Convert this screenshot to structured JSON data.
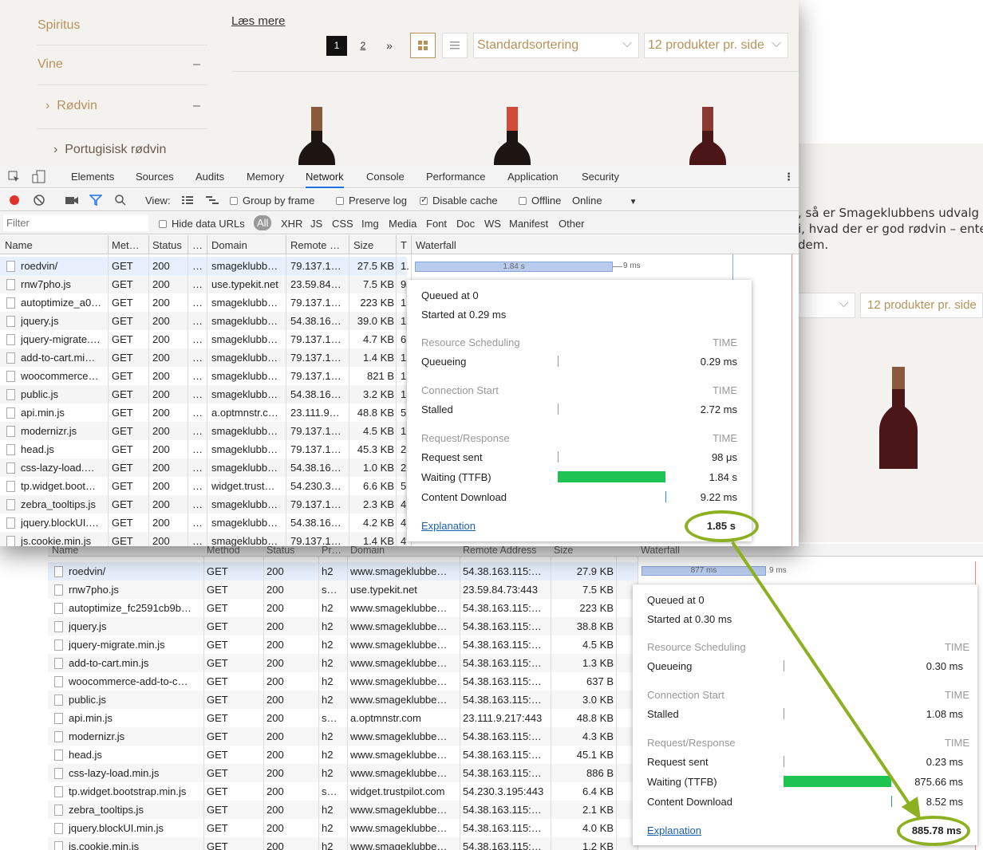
{
  "site": {
    "read_more": "Læs mere",
    "sidebar": [
      "Spiritus",
      "Vine",
      "Rødvin",
      "Portugisisk rødvin"
    ],
    "sidebar_minus": "–",
    "pagination": [
      "1",
      "2",
      "»"
    ],
    "sort_label": "Standardsortering",
    "per_page_label": "12 produkter pr. side",
    "right_text": [
      ", så er Smageklubbens udvalg af c",
      "i, hvad der er god rødvin – enten",
      "dem."
    ]
  },
  "devtools_tabs": [
    "Elements",
    "Sources",
    "Audits",
    "Memory",
    "Network",
    "Console",
    "Performance",
    "Application",
    "Security"
  ],
  "toolbar": {
    "view_label": "View:",
    "group_by_frame": "Group by frame",
    "preserve_log": "Preserve log",
    "disable_cache": "Disable cache",
    "offline": "Offline",
    "online": "Online"
  },
  "filterbar": {
    "filter_placeholder": "Filter",
    "hide_data_urls": "Hide data URLs",
    "types": [
      "All",
      "XHR",
      "JS",
      "CSS",
      "Img",
      "Media",
      "Font",
      "Doc",
      "WS",
      "Manifest",
      "Other"
    ]
  },
  "net1": {
    "headers": [
      "Name",
      "Met…",
      "Status",
      "…",
      "Domain",
      "Remote …",
      "Size",
      "T",
      "Waterfall"
    ],
    "bar_label": "1.84 s",
    "bar_end_label": "9 ms",
    "rows": [
      [
        "roedvin/",
        "GET",
        "200",
        "…",
        "smageklubb…",
        "79.137.1…",
        "27.5 KB",
        "1."
      ],
      [
        "rnw7pho.js",
        "GET",
        "200",
        "…",
        "use.typekit.net",
        "23.59.84…",
        "7.5 KB",
        "9"
      ],
      [
        "autoptimize_a0…",
        "GET",
        "200",
        "…",
        "smageklubb…",
        "79.137.1…",
        "223 KB",
        "1"
      ],
      [
        "jquery.js",
        "GET",
        "200",
        "…",
        "smageklubb…",
        "54.38.16…",
        "39.0 KB",
        "1"
      ],
      [
        "jquery-migrate.…",
        "GET",
        "200",
        "…",
        "smageklubb…",
        "79.137.1…",
        "4.7 KB",
        "6"
      ],
      [
        "add-to-cart.mi…",
        "GET",
        "200",
        "…",
        "smageklubb…",
        "79.137.1…",
        "1.4 KB",
        "1"
      ],
      [
        "woocommerce…",
        "GET",
        "200",
        "…",
        "smageklubb…",
        "79.137.1…",
        "821 B",
        "1"
      ],
      [
        "public.js",
        "GET",
        "200",
        "…",
        "smageklubb…",
        "54.38.16…",
        "3.2 KB",
        "1"
      ],
      [
        "api.min.js",
        "GET",
        "200",
        "…",
        "a.optmnstr.c…",
        "23.111.9…",
        "48.8 KB",
        "5"
      ],
      [
        "modernizr.js",
        "GET",
        "200",
        "…",
        "smageklubb…",
        "79.137.1…",
        "4.5 KB",
        "1"
      ],
      [
        "head.js",
        "GET",
        "200",
        "…",
        "smageklubb…",
        "79.137.1…",
        "45.3 KB",
        "2"
      ],
      [
        "css-lazy-load.…",
        "GET",
        "200",
        "…",
        "smageklubb…",
        "54.38.16…",
        "1.0 KB",
        "2"
      ],
      [
        "tp.widget.boot…",
        "GET",
        "200",
        "…",
        "widget.trust…",
        "54.230.3…",
        "6.6 KB",
        "5"
      ],
      [
        "zebra_tooltips.js",
        "GET",
        "200",
        "…",
        "smageklubb…",
        "79.137.1…",
        "2.3 KB",
        "4"
      ],
      [
        "jquery.blockUI.…",
        "GET",
        "200",
        "…",
        "smageklubb…",
        "54.38.16…",
        "4.2 KB",
        "4"
      ],
      [
        "js.cookie.min.js",
        "GET",
        "200",
        "…",
        "smageklubb…",
        "79.137.1…",
        "1.4 KB",
        "4"
      ]
    ]
  },
  "tip1": {
    "queued": "Queued at 0",
    "started": "Started at 0.29 ms",
    "sec1": "Resource Scheduling",
    "sec2": "Connection Start",
    "sec3": "Request/Response",
    "time": "TIME",
    "queueing": "Queueing",
    "queueing_v": "0.29 ms",
    "stalled": "Stalled",
    "stalled_v": "2.72 ms",
    "req_sent": "Request sent",
    "req_sent_v": "98 μs",
    "waiting": "Waiting (TTFB)",
    "waiting_v": "1.84 s",
    "download": "Content Download",
    "download_v": "9.22 ms",
    "explanation": "Explanation",
    "total": "1.85 s"
  },
  "net2": {
    "headers": [
      "Name",
      "Method",
      "Status",
      "Pr…",
      "Domain",
      "Remote Address",
      "Size",
      "Waterfall"
    ],
    "bar_label": "877 ms",
    "bar_end_label": "9 ms",
    "rows": [
      [
        "roedvin/",
        "GET",
        "200",
        "h2",
        "www.smageklubbe…",
        "54.38.163.115:…",
        "27.9 KB"
      ],
      [
        "rnw7pho.js",
        "GET",
        "200",
        "s…",
        "use.typekit.net",
        "23.59.84.73:443",
        "7.5 KB"
      ],
      [
        "autoptimize_fc2591cb9b…",
        "GET",
        "200",
        "h2",
        "www.smageklubbe…",
        "54.38.163.115:…",
        "223 KB"
      ],
      [
        "jquery.js",
        "GET",
        "200",
        "h2",
        "www.smageklubbe…",
        "54.38.163.115:…",
        "38.8 KB"
      ],
      [
        "jquery-migrate.min.js",
        "GET",
        "200",
        "h2",
        "www.smageklubbe…",
        "54.38.163.115:…",
        "4.5 KB"
      ],
      [
        "add-to-cart.min.js",
        "GET",
        "200",
        "h2",
        "www.smageklubbe…",
        "54.38.163.115:…",
        "1.3 KB"
      ],
      [
        "woocommerce-add-to-c…",
        "GET",
        "200",
        "h2",
        "www.smageklubbe…",
        "54.38.163.115:…",
        "637 B"
      ],
      [
        "public.js",
        "GET",
        "200",
        "h2",
        "www.smageklubbe…",
        "54.38.163.115:…",
        "3.0 KB"
      ],
      [
        "api.min.js",
        "GET",
        "200",
        "s…",
        "a.optmnstr.com",
        "23.111.9.217:443",
        "48.8 KB"
      ],
      [
        "modernizr.js",
        "GET",
        "200",
        "h2",
        "www.smageklubbe…",
        "54.38.163.115:…",
        "4.3 KB"
      ],
      [
        "head.js",
        "GET",
        "200",
        "h2",
        "www.smageklubbe…",
        "54.38.163.115:…",
        "45.1 KB"
      ],
      [
        "css-lazy-load.min.js",
        "GET",
        "200",
        "h2",
        "www.smageklubbe…",
        "54.38.163.115:…",
        "886 B"
      ],
      [
        "tp.widget.bootstrap.min.js",
        "GET",
        "200",
        "s…",
        "widget.trustpilot.com",
        "54.230.3.195:443",
        "6.4 KB"
      ],
      [
        "zebra_tooltips.js",
        "GET",
        "200",
        "h2",
        "www.smageklubbe…",
        "54.38.163.115:…",
        "2.1 KB"
      ],
      [
        "jquery.blockUI.min.js",
        "GET",
        "200",
        "h2",
        "www.smageklubbe…",
        "54.38.163.115:…",
        "4.0 KB"
      ],
      [
        "js.cookie.min.js",
        "GET",
        "200",
        "h2",
        "www.smageklubbe…",
        "54.38.163.115:…",
        "1.2 KB"
      ]
    ]
  },
  "tip2": {
    "queued": "Queued at 0",
    "started": "Started at 0.30 ms",
    "sec1": "Resource Scheduling",
    "sec2": "Connection Start",
    "sec3": "Request/Response",
    "time": "TIME",
    "queueing": "Queueing",
    "queueing_v": "0.30 ms",
    "stalled": "Stalled",
    "stalled_v": "1.08 ms",
    "req_sent": "Request sent",
    "req_sent_v": "0.23 ms",
    "waiting": "Waiting (TTFB)",
    "waiting_v": "875.66 ms",
    "download": "Content Download",
    "download_v": "8.52 ms",
    "explanation": "Explanation",
    "total": "885.78 ms"
  },
  "colors": {
    "accent": "#b5935a",
    "ttfb": "#1ec451",
    "annotation": "#8db021",
    "selected_row": "#e8f0fd"
  }
}
